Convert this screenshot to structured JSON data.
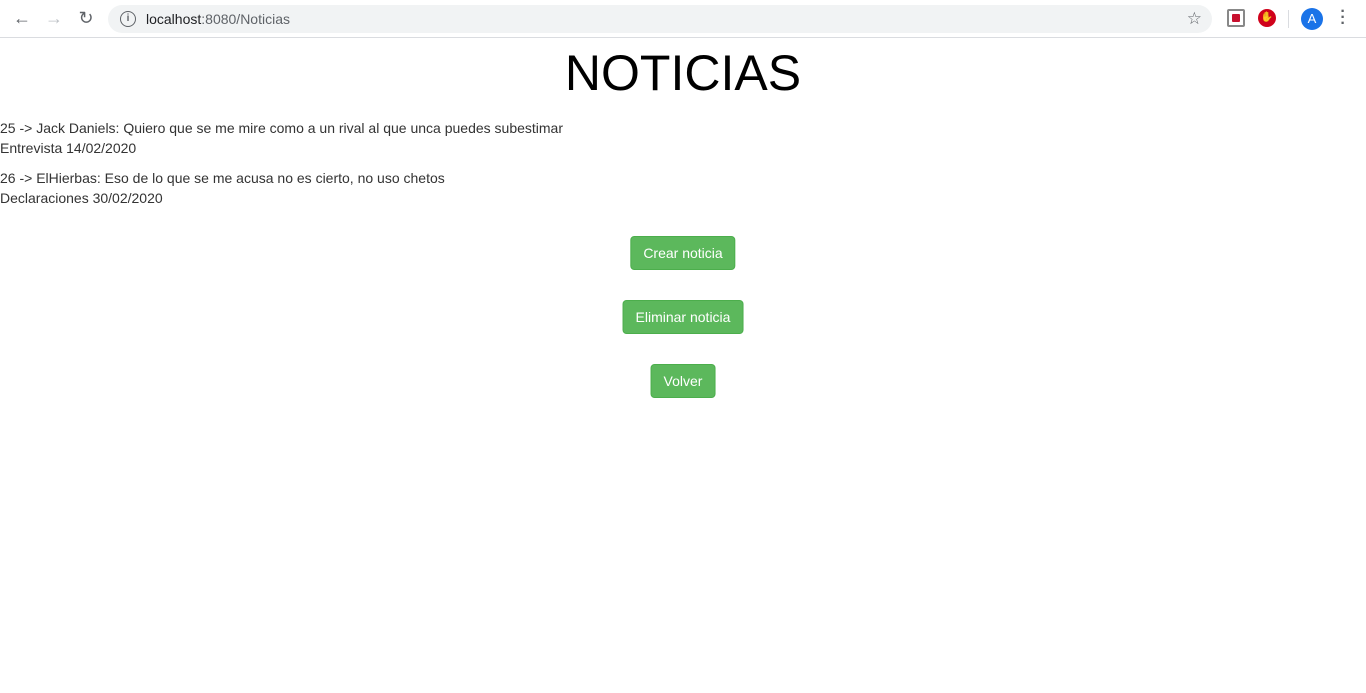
{
  "browser": {
    "url_host": "localhost",
    "url_path": ":8080/Noticias",
    "avatar_letter": "A",
    "ext2_glyph": "✋"
  },
  "page": {
    "title": "NOTICIAS"
  },
  "news": [
    {
      "headline": "25 -> Jack Daniels: Quiero que se me mire como a un rival al que unca puedes subestimar",
      "meta": "Entrevista 14/02/2020"
    },
    {
      "headline": "26 -> ElHierbas: Eso de lo que se me acusa no es cierto, no uso chetos",
      "meta": "Declaraciones 30/02/2020"
    }
  ],
  "buttons": {
    "create": "Crear noticia",
    "delete": "Eliminar noticia",
    "back": "Volver"
  },
  "colors": {
    "button": "#5cb85c"
  }
}
